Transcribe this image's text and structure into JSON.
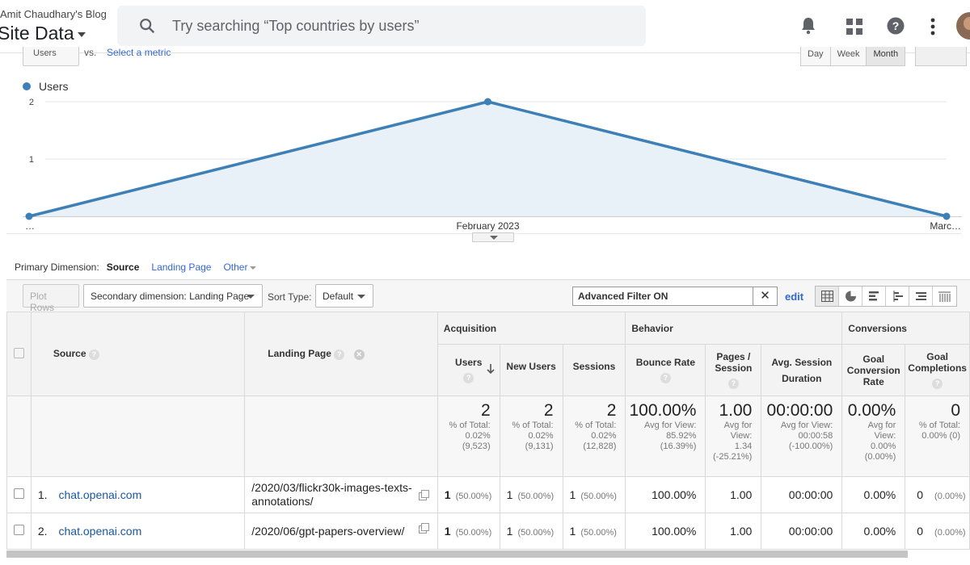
{
  "header": {
    "account": "Amit Chaudhary's Blog",
    "property": "Site Data",
    "search_placeholder": "Try searching “Top countries by users”"
  },
  "chart_controls": {
    "metric": "Users",
    "vs": "vs.",
    "select_metric": "Select a metric",
    "ranges": [
      "Day",
      "Week",
      "Month"
    ]
  },
  "chart_data": {
    "type": "area",
    "series": [
      {
        "name": "Users",
        "color": "#3d7fb7",
        "values": [
          0,
          2,
          0
        ]
      }
    ],
    "x_labels": [
      "…",
      "February 2023",
      "Marc…"
    ],
    "y_ticks": [
      "1",
      "2"
    ],
    "ylim": [
      0,
      2
    ],
    "grid": true
  },
  "dimension": {
    "label": "Primary Dimension:",
    "current": "Source",
    "landing": "Landing Page",
    "other": "Other"
  },
  "toolbar": {
    "plot_rows": "Plot Rows",
    "secondary": "Secondary dimension: Landing Page",
    "sort_label": "Sort Type:",
    "sort_value": "Default",
    "filter": "Advanced Filter ON",
    "filter_clear": "✕",
    "edit": "edit"
  },
  "table": {
    "groups": {
      "acq": "Acquisition",
      "beh": "Behavior",
      "conv": "Conversions"
    },
    "cols": {
      "source": "Source",
      "landing": "Landing Page",
      "users": "Users",
      "new_users": "New Users",
      "sessions": "Sessions",
      "bounce": "Bounce Rate",
      "pages": "Pages / Session",
      "duration": "Avg. Session Duration",
      "goal_rate": "Goal Conversion Rate",
      "goal_comp": "Goal Completions"
    },
    "help": "?",
    "totals": {
      "users": {
        "big": "2",
        "l1": "% of Total:",
        "l2": "0.02%",
        "l3": "(9,523)"
      },
      "new_users": {
        "big": "2",
        "l1": "% of Total:",
        "l2": "0.02%",
        "l3": "(9,131)"
      },
      "sessions": {
        "big": "2",
        "l1": "% of Total:",
        "l2": "0.02%",
        "l3": "(12,828)"
      },
      "bounce": {
        "big": "100.00%",
        "l1": "Avg for View:",
        "l2": "85.92%",
        "l3": "(16.39%)"
      },
      "pages": {
        "big": "1.00",
        "l1": "Avg for",
        "l2": "View:",
        "l3": "1.34",
        "l4": "(-25.21%)"
      },
      "duration": {
        "big": "00:00:00",
        "l1": "Avg for View:",
        "l2": "00:00:58",
        "l3": "(-100.00%)"
      },
      "goal_rate": {
        "big": "0.00%",
        "l1": "Avg for",
        "l2": "View:",
        "l3": "0.00%",
        "l4": "(0.00%)"
      },
      "goal_comp": {
        "big": "0",
        "l1": "% of Total:",
        "l2": "0.00% (0)"
      }
    },
    "rows": [
      {
        "idx": "1.",
        "source": "chat.openai.com",
        "landing": "/2020/03/flickr30k-images-texts-annotations/",
        "users": "1",
        "users_pct": "(50.00%)",
        "new_users": "1",
        "new_users_pct": "(50.00%)",
        "sessions": "1",
        "sessions_pct": "(50.00%)",
        "bounce": "100.00%",
        "pages": "1.00",
        "duration": "00:00:00",
        "goal_rate": "0.00%",
        "goal_comp": "0",
        "goal_comp_pct": "(0.00%)"
      },
      {
        "idx": "2.",
        "source": "chat.openai.com",
        "landing": "/2020/06/gpt-papers-overview/",
        "users": "1",
        "users_pct": "(50.00%)",
        "new_users": "1",
        "new_users_pct": "(50.00%)",
        "sessions": "1",
        "sessions_pct": "(50.00%)",
        "bounce": "100.00%",
        "pages": "1.00",
        "duration": "00:00:00",
        "goal_rate": "0.00%",
        "goal_comp": "0",
        "goal_comp_pct": "(0.00%)"
      }
    ]
  }
}
